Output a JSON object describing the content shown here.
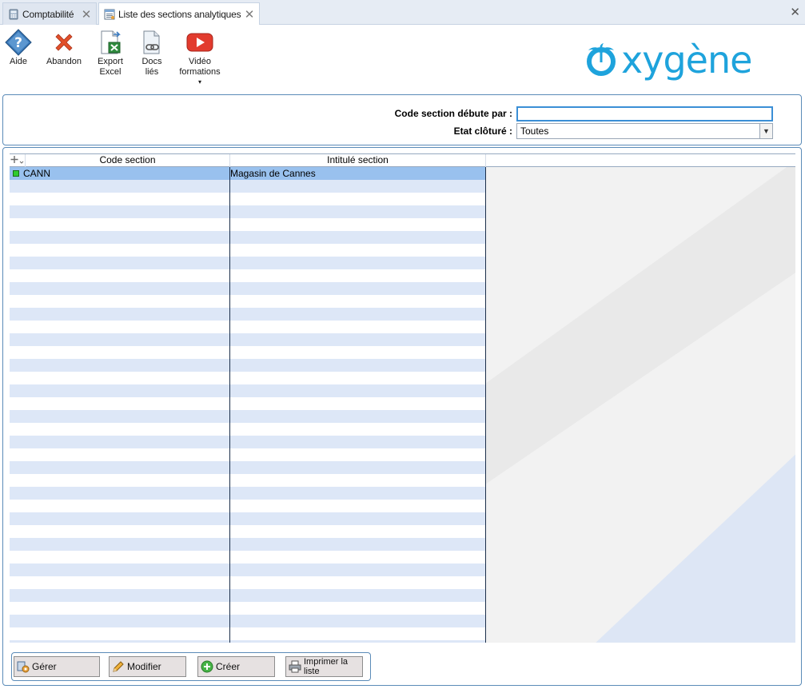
{
  "tabs": [
    {
      "label": "Comptabilité",
      "icon": "calculator-icon"
    },
    {
      "label": "Liste des sections analytiques",
      "icon": "list-window-icon"
    }
  ],
  "toolbar": {
    "aide": "Aide",
    "abandon": "Abandon",
    "export_excel": "Export\nExcel",
    "docs_lies": "Docs\nliés",
    "video_formations": "Vidéo\nformations",
    "video_caret": "▾"
  },
  "logo": {
    "text": "xygène",
    "brand_color": "#1ea3dc"
  },
  "filters": {
    "code_label": "Code section débute par :",
    "code_value": "",
    "etat_label": "Etat clôturé :",
    "etat_value": "Toutes"
  },
  "grid": {
    "columns": [
      "Code section",
      "Intitulé section"
    ],
    "rows": [
      {
        "code": "CANN",
        "intitule": "Magasin de Cannes",
        "selected": true
      }
    ],
    "selection_color": "#99c1ee",
    "alt_row_color": "#dde7f7"
  },
  "buttons": {
    "gerer": "Gérer",
    "modifier": "Modifier",
    "creer": "Créer",
    "imprimer": "Imprimer la liste"
  }
}
